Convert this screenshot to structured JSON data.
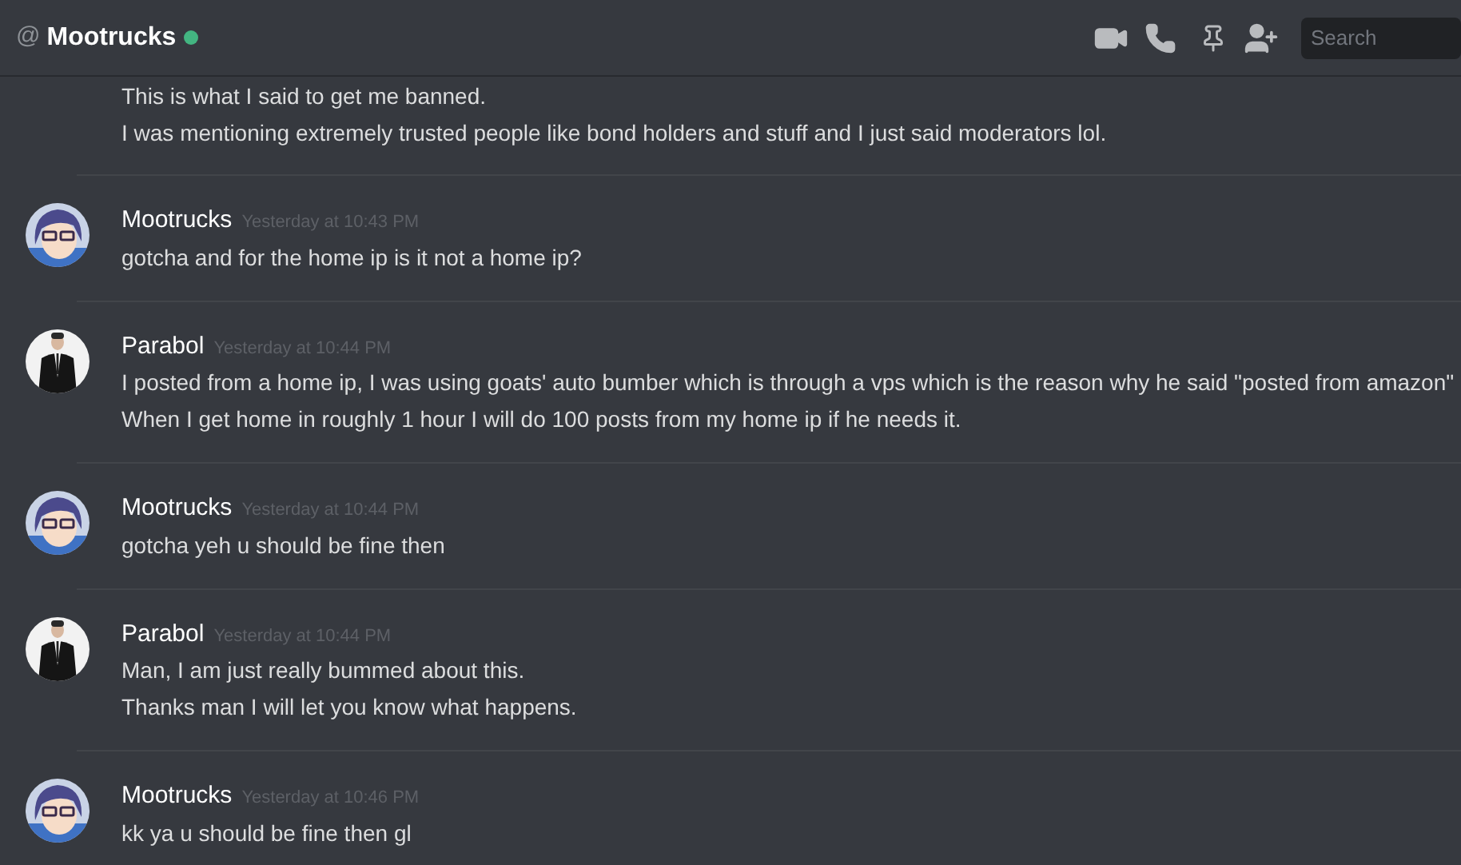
{
  "header": {
    "prefix": "@",
    "title": "Mootrucks",
    "online": true,
    "search": {
      "placeholder": "Search"
    }
  },
  "partial_message": {
    "lines": [
      "This is what I said to get me banned.",
      "I was mentioning extremely trusted people like bond holders and stuff and I just said moderators lol."
    ]
  },
  "messages": [
    {
      "author": "Mootrucks",
      "kind": "anime",
      "time": "Yesterday at 10:43 PM",
      "lines": [
        "gotcha and for the home ip is it not a home ip?"
      ]
    },
    {
      "author": "Parabol",
      "kind": "suit",
      "time": "Yesterday at 10:44 PM",
      "lines": [
        "I posted from a home ip, I was using goats' auto bumber which is through a vps which is the reason why he said \"posted from amazon\"",
        "When I get home in roughly 1 hour I will do 100 posts from my home ip if he needs it."
      ]
    },
    {
      "author": "Mootrucks",
      "kind": "anime",
      "time": "Yesterday at 10:44 PM",
      "lines": [
        "gotcha yeh u should be fine then"
      ]
    },
    {
      "author": "Parabol",
      "kind": "suit",
      "time": "Yesterday at 10:44 PM",
      "lines": [
        "Man, I am just really bummed about this.",
        "Thanks man I will let you know what happens."
      ]
    },
    {
      "author": "Mootrucks",
      "kind": "anime",
      "time": "Yesterday at 10:46 PM",
      "lines": [
        "kk ya u should be fine then gl"
      ]
    }
  ]
}
